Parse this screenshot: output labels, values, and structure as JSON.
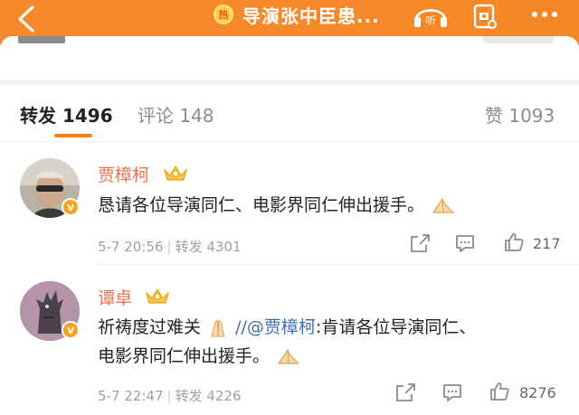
{
  "header": {
    "title": "导演张中臣患...",
    "hot_badge": "热",
    "listen_label": "听",
    "accent_color": "#f7892a"
  },
  "tabs": {
    "repost_label": "转发",
    "repost_count": "1496",
    "comment_label": "评论",
    "comment_count": "148",
    "like_label": "赞",
    "like_count": "1093"
  },
  "reposts": [
    {
      "user": "贾樟柯",
      "text": "恳请各位导演同仁、电影界同仁伸出援手。",
      "time": "5-7 20:56",
      "repost_label": "转发",
      "repost_count": "4301",
      "likes": "217",
      "verified_badge": "v"
    },
    {
      "user": "谭卓",
      "text_prefix": "祈祷度过难关",
      "mention": "//@贾樟柯",
      "text_suffix": ":肯请各位导演同仁、",
      "text_line2": "电影界同仁伸出援手。",
      "time": "5-7 22:47",
      "repost_label": "转发",
      "repost_count": "4226",
      "likes": "8276",
      "verified_badge": "v"
    }
  ],
  "icons": [
    "back-icon",
    "listen-icon",
    "gift-icon",
    "more-icon",
    "share-icon",
    "comment-icon",
    "like-icon",
    "crown-icon",
    "praying-hands-icon"
  ]
}
